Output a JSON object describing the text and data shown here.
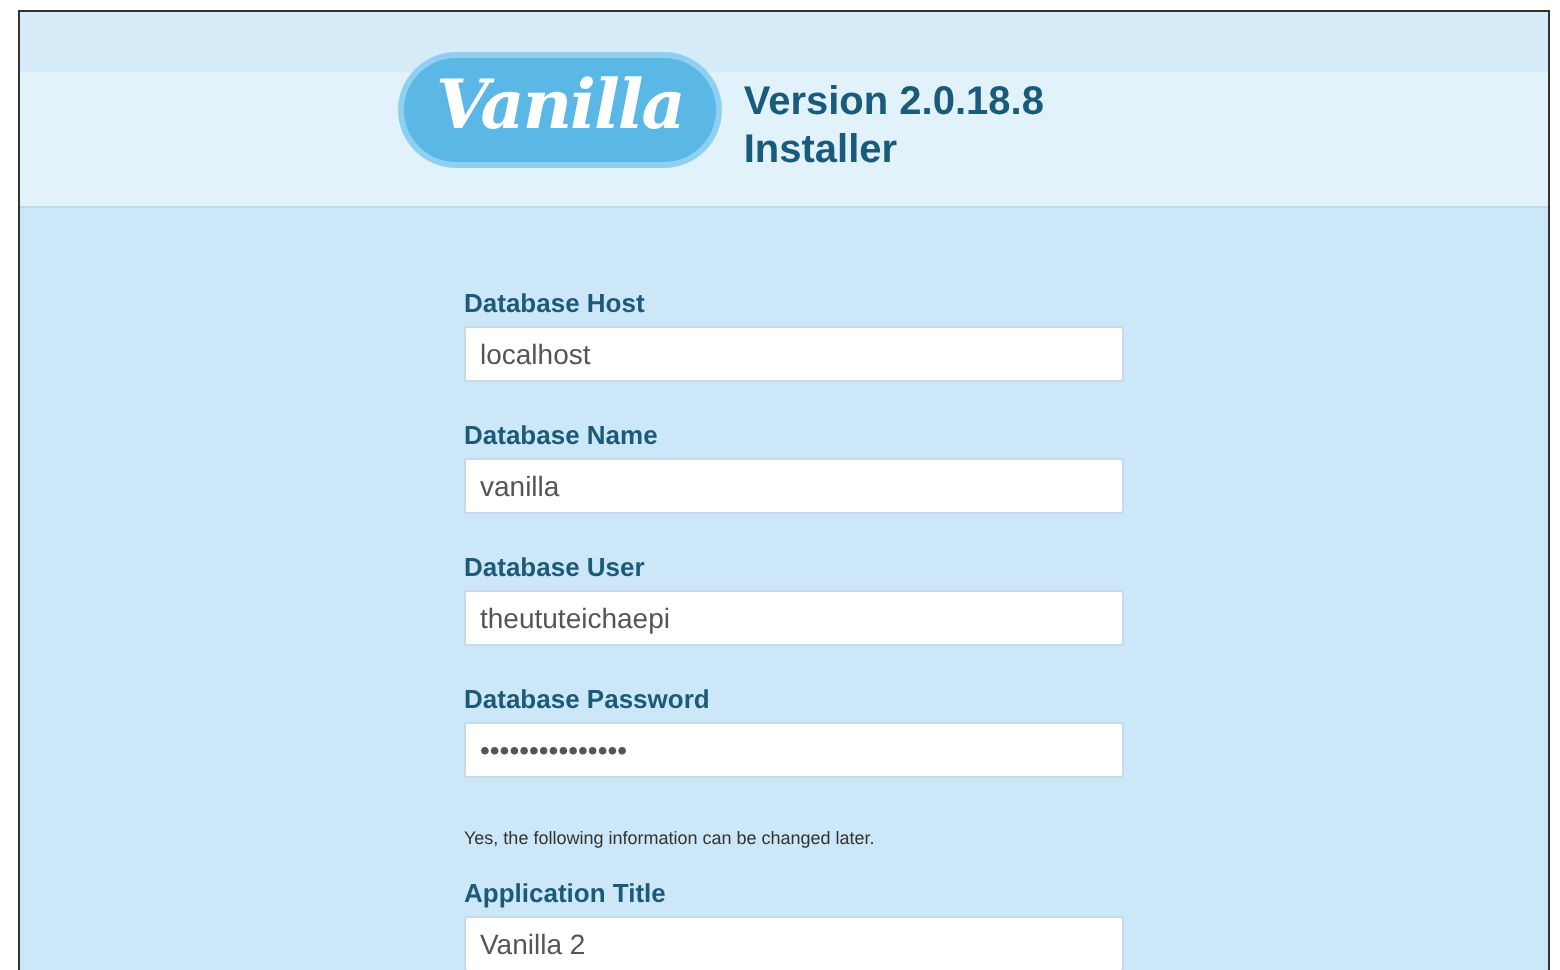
{
  "header": {
    "logo": "Vanilla",
    "version": "Version 2.0.18.8",
    "subtitle": "Installer"
  },
  "fields": [
    {
      "label": "Database Host",
      "value": "localhost"
    },
    {
      "label": "Database Name",
      "value": "vanilla"
    },
    {
      "label": "Database User",
      "value": "theututeichaepi"
    },
    {
      "label": "Database Password",
      "value": "•••••••••••••••"
    }
  ],
  "note": "Yes, the following information can be changed later.",
  "app_fields": [
    {
      "label": "Application Title",
      "value": "Vanilla 2"
    }
  ]
}
